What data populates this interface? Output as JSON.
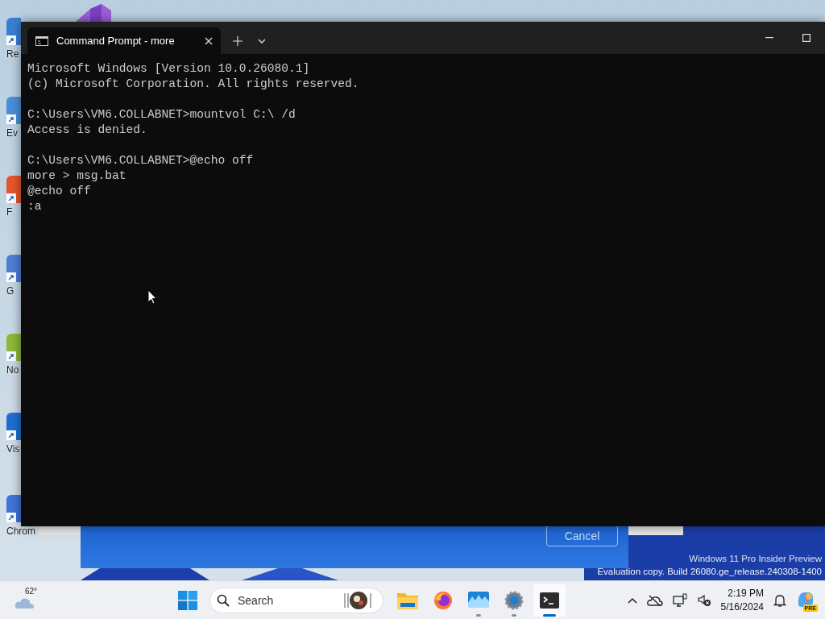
{
  "desktop_icons": [
    {
      "label": "Re",
      "color": "#3b7fd4"
    },
    {
      "label": "Ev",
      "color": "#4a8fd8"
    },
    {
      "label": "F",
      "color": "#e8552a"
    },
    {
      "label": "G",
      "color": "#4d7fd6"
    },
    {
      "label": "No",
      "color": "#8fb83a"
    },
    {
      "label": "Vis",
      "color": "#1f6fd0"
    },
    {
      "label": "Chrom",
      "color": "#3f74d8"
    }
  ],
  "terminal": {
    "tab_title": "Command Prompt - more",
    "output_blocks": [
      [
        "Microsoft Windows [Version 10.0.26080.1]",
        "(c) Microsoft Corporation. All rights reserved."
      ],
      [
        "C:\\Users\\VM6.COLLABNET>mountvol C:\\ /d",
        "Access is denied."
      ],
      [
        "C:\\Users\\VM6.COLLABNET>@echo off",
        "more > msg.bat",
        "@echo off",
        ":a"
      ]
    ]
  },
  "background_dialog": {
    "button": "Cancel"
  },
  "os_watermark": [
    "Windows 11 Pro Insider Preview",
    "Evaluation copy. Build 26080.ge_release.240308-1400"
  ],
  "taskbar": {
    "weather": "62°",
    "search": {
      "placeholder": "Search"
    },
    "apps": [
      {
        "kind": "explorer",
        "running": false,
        "selected": false
      },
      {
        "kind": "firefox",
        "running": false,
        "selected": false
      },
      {
        "kind": "monitor",
        "running": true,
        "selected": false
      },
      {
        "kind": "settings",
        "running": true,
        "selected": false
      },
      {
        "kind": "terminal",
        "running": true,
        "selected": true
      }
    ],
    "time": "2:19 PM",
    "date": "5/16/2024",
    "copilot_badge": "PRE"
  }
}
